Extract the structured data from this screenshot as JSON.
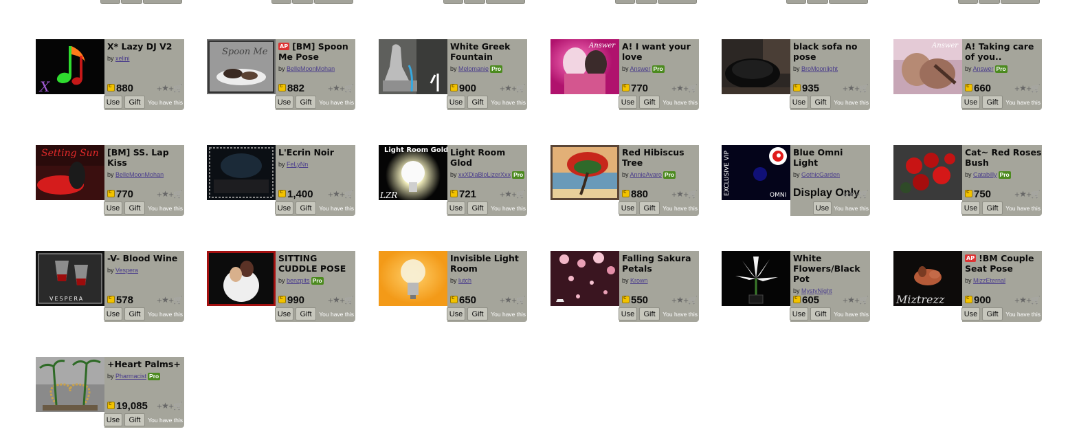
{
  "buttons": {
    "use": "Use",
    "gift": "Gift",
    "owned": "You have this"
  },
  "labels": {
    "by": "by",
    "pro": "Pro",
    "ap": "AP",
    "display_only": "Display Only"
  },
  "products": [
    {
      "title": "X* Lazy DJ V2",
      "creator": "xelini",
      "pro": false,
      "ap": false,
      "price": "880",
      "thumb": "music-note"
    },
    {
      "title": "[BM] Spoon Me Pose",
      "creator": "BelleMoonMohan",
      "pro": false,
      "ap": true,
      "price": "882",
      "thumb": "spoon-pose"
    },
    {
      "title": "White Greek Fountain",
      "creator": "Melomanie",
      "pro": true,
      "ap": false,
      "price": "900",
      "thumb": "fountain"
    },
    {
      "title": "A! I want your love",
      "creator": "Answer",
      "pro": true,
      "ap": false,
      "price": "770",
      "thumb": "couple-pink"
    },
    {
      "title": "black sofa no pose",
      "creator": "BroMoonlight",
      "pro": false,
      "ap": false,
      "price": "935",
      "thumb": "black-sofa"
    },
    {
      "title": "A! Taking care of you..",
      "creator": "Answer",
      "pro": true,
      "ap": false,
      "price": "660",
      "thumb": "couple-bed"
    },
    {
      "title": "[BM] SS. Lap Kiss",
      "creator": "BelleMoonMohan",
      "pro": false,
      "ap": false,
      "price": "770",
      "thumb": "lap-kiss"
    },
    {
      "title": "L'Ecrin Noir",
      "creator": "FeLyNn",
      "pro": false,
      "ap": false,
      "price": "1,400",
      "thumb": "ecrin-noir"
    },
    {
      "title": "Light Room Glod",
      "creator": "xxXDiaBloLizerXxx",
      "pro": true,
      "ap": false,
      "price": "721",
      "thumb": "bulb-dark"
    },
    {
      "title": "Red Hibiscus Tree",
      "creator": "AnnieAvaro",
      "pro": true,
      "ap": false,
      "price": "880",
      "thumb": "hibiscus-tree"
    },
    {
      "title": "Blue Omni Light",
      "creator": "GothicGarden",
      "pro": false,
      "ap": false,
      "price": null,
      "display_only": true,
      "thumb": "omni-light"
    },
    {
      "title": "Cat~ Red Roses Bush",
      "creator": "Catabilly",
      "pro": true,
      "ap": false,
      "price": "750",
      "thumb": "red-roses"
    },
    {
      "title": "-V- Blood Wine",
      "creator": "Vespera",
      "pro": false,
      "ap": false,
      "price": "578",
      "thumb": "blood-wine"
    },
    {
      "title": "SITTING CUDDLE POSE",
      "creator": "benzpits",
      "pro": true,
      "ap": false,
      "price": "990",
      "thumb": "cuddle-pose"
    },
    {
      "title": "Invisible Light Room",
      "creator": "lutch",
      "pro": false,
      "ap": false,
      "price": "650",
      "thumb": "bulb-orange"
    },
    {
      "title": "Falling Sakura Petals",
      "creator": "Krown",
      "pro": false,
      "ap": false,
      "price": "550",
      "thumb": "sakura"
    },
    {
      "title": "White Flowers/Black Pot",
      "creator": "MystyNight",
      "pro": false,
      "ap": false,
      "price": "605",
      "thumb": "white-flowers"
    },
    {
      "title": "!BM Couple Seat Pose",
      "creator": "MizzEternal",
      "pro": false,
      "ap": true,
      "price": "900",
      "thumb": "couple-seat"
    },
    {
      "title": "+Heart Palms+",
      "creator": "Pharmacist",
      "pro": true,
      "ap": false,
      "price": "19,085",
      "thumb": "heart-palms"
    }
  ],
  "thumb_text": {
    "spoon": "Spoon Me",
    "light_room": "Light Room Gold",
    "lzr": "LZR",
    "exclusive": "EXCLUSIVE VIP",
    "omni": "OMNI",
    "vespera": "VESPERA",
    "mizt": "Miztrezz",
    "answer": "Answer",
    "setting": "Setting Sun"
  }
}
